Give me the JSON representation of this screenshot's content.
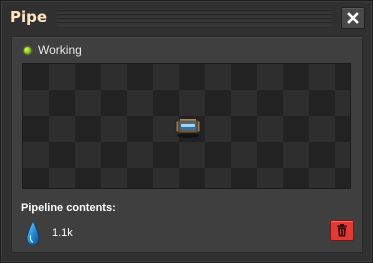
{
  "window": {
    "title": "Pipe",
    "close_icon": "close-icon"
  },
  "status": {
    "text": "Working",
    "indicator_color": "#9ad51e"
  },
  "preview": {
    "entity_icon": "pipe-icon"
  },
  "pipeline": {
    "label": "Pipeline contents:",
    "fluid_icon": "water-drop-icon",
    "amount": "1.1k"
  },
  "actions": {
    "flush_icon": "trash-icon",
    "flush_color": "#e33a35"
  }
}
